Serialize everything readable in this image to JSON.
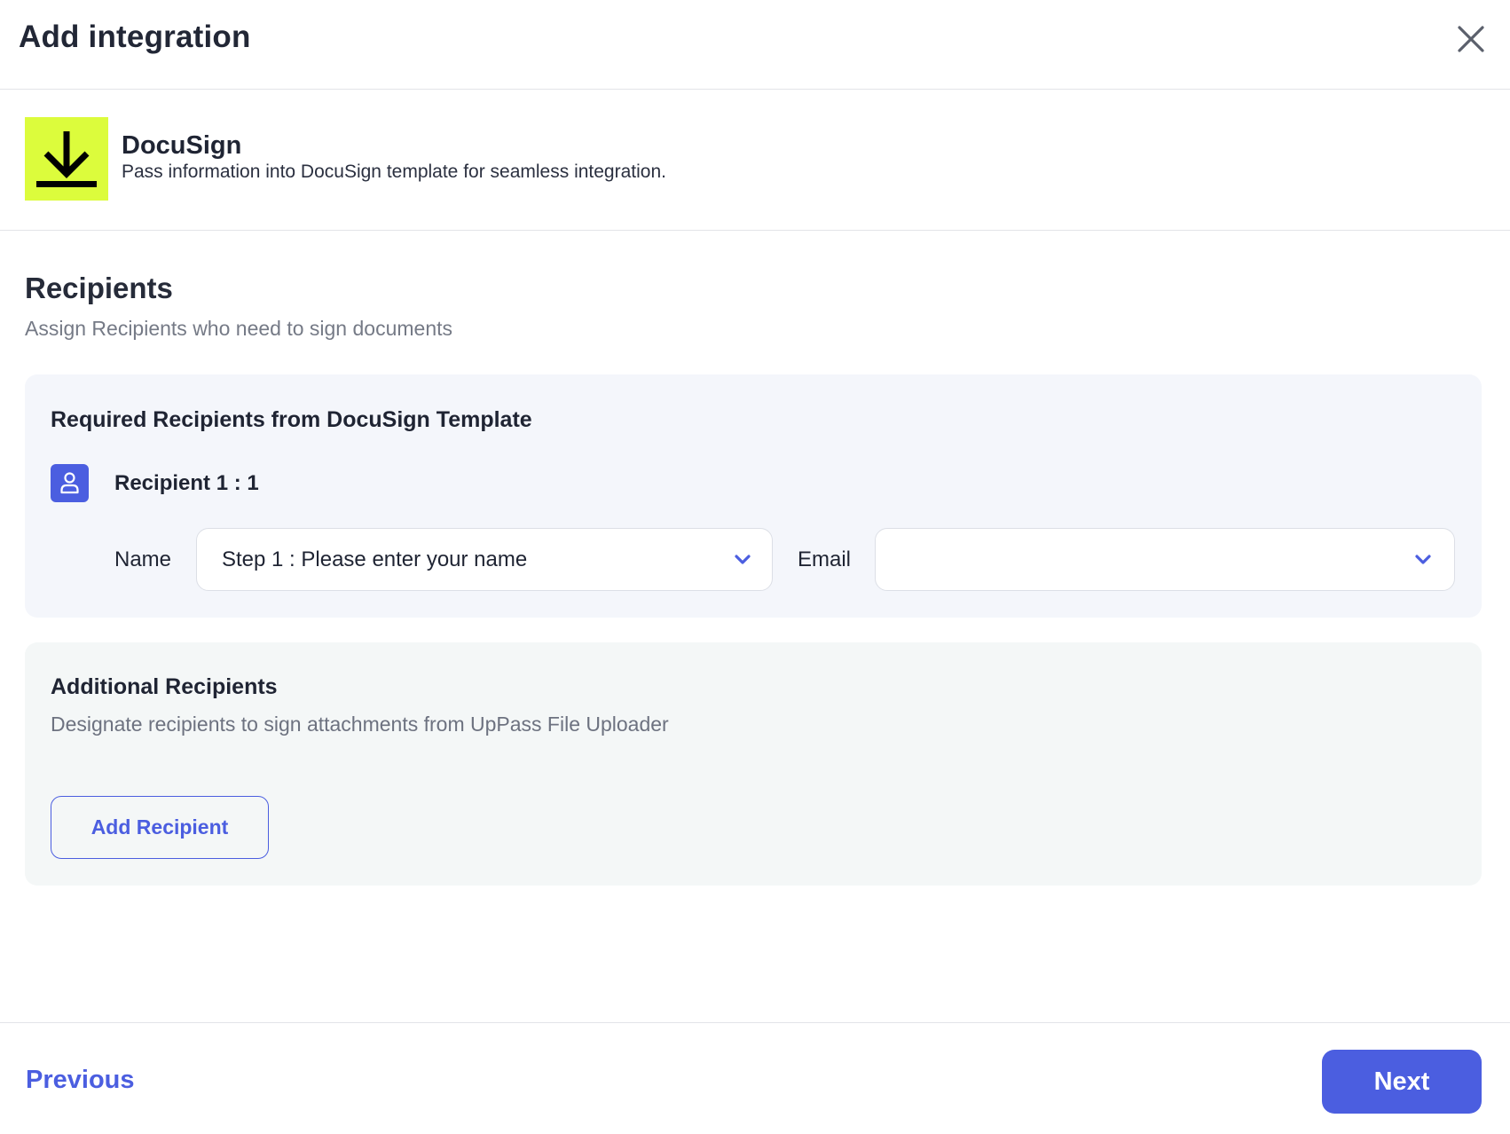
{
  "header": {
    "title": "Add integration",
    "close_icon": "close-icon"
  },
  "integration": {
    "logo_icon": "download-icon",
    "logo_color": "#dcfc3c",
    "name": "DocuSign",
    "description": "Pass information into DocuSign template for seamless integration."
  },
  "recipients": {
    "title": "Recipients",
    "subtitle": "Assign Recipients who need to sign documents"
  },
  "required_panel": {
    "title": "Required Recipients from DocuSign Template",
    "recipient": {
      "icon": "user-icon",
      "label": "Recipient 1 : 1",
      "name_label": "Name",
      "name_value": "Step 1 : Please enter your name",
      "email_label": "Email",
      "email_value": ""
    }
  },
  "additional_panel": {
    "title": "Additional Recipients",
    "description": "Designate recipients to sign attachments from UpPass File Uploader",
    "add_button_label": "Add Recipient"
  },
  "footer": {
    "previous_label": "Previous",
    "next_label": "Next"
  },
  "colors": {
    "accent": "#4b5ee0",
    "panel_required_bg": "#f4f6fb",
    "panel_additional_bg": "#f4f7f7"
  }
}
